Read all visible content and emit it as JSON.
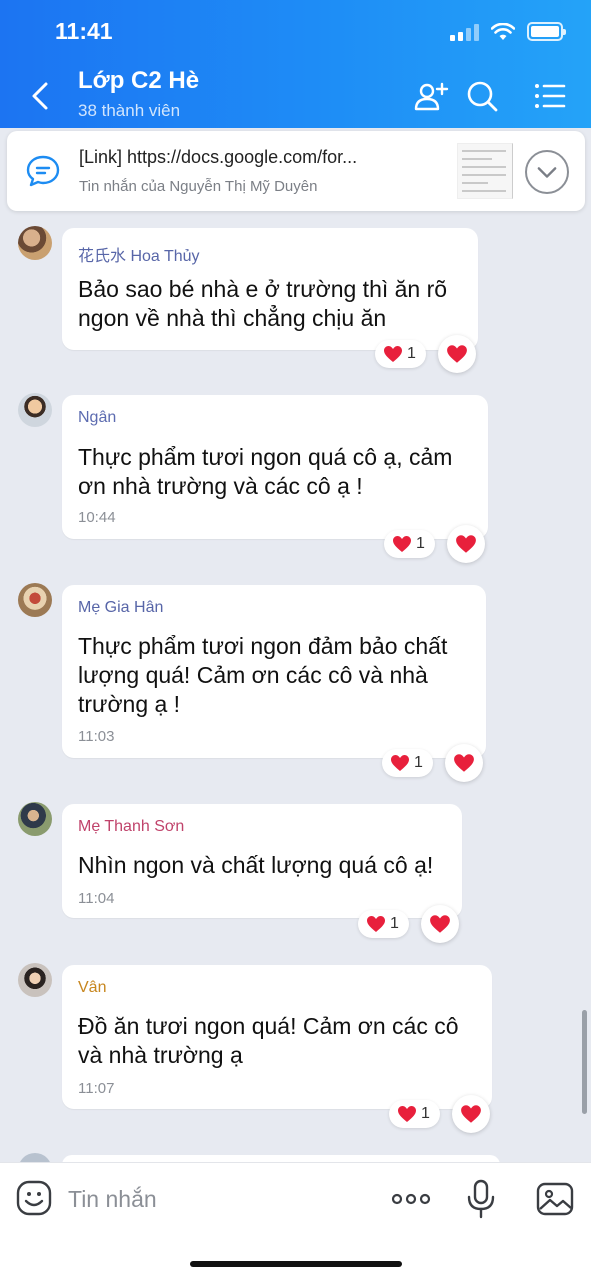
{
  "status_bar": {
    "time": "11:41"
  },
  "header": {
    "title": "Lớp C2 Hè",
    "subtitle": "38 thành viên",
    "icons": [
      "back-chevron-icon",
      "add-member-icon",
      "search-icon",
      "menu-list-icon"
    ]
  },
  "pinned": {
    "title": "[Link] https://docs.google.com/for...",
    "subtitle": "Tin nhắn của Nguyễn Thị Mỹ Duyên"
  },
  "messages": [
    {
      "sender": "花氏水 Hoa Thủy",
      "sender_color": "#5866a8",
      "text_lines": [
        "Bảo sao bé nhà e ở trường thì ăn rõ",
        "ngon về nhà thì chẳng chịu ăn"
      ],
      "time": "",
      "reaction_count": "1",
      "reaction": "heart"
    },
    {
      "sender": "Ngân",
      "sender_color": "#5c6bb0",
      "text_lines": [
        "Thực phẩm tươi ngon quá cô ạ, cảm",
        "ơn nhà trường và các cô ạ !"
      ],
      "time": "10:44",
      "reaction_count": "1",
      "reaction": "heart"
    },
    {
      "sender": "Mẹ Gia Hân",
      "sender_color": "#5866a8",
      "text_lines": [
        "Thực phẩm tươi ngon đảm bảo chất",
        "lượng quá! Cảm ơn các cô và nhà",
        "trường ạ !"
      ],
      "time": "11:03",
      "reaction_count": "1",
      "reaction": "heart"
    },
    {
      "sender": "Mẹ Thanh Sơn",
      "sender_color": "#c0436b",
      "text_lines": [
        "Nhìn ngon và chất lượng quá cô ạ!"
      ],
      "time": "11:04",
      "reaction_count": "1",
      "reaction": "heart"
    },
    {
      "sender": "Vân",
      "sender_color": "#c7861e",
      "text_lines": [
        "Đồ ăn tươi ngon quá! Cảm ơn các cô",
        "và nhà trường ạ"
      ],
      "time": "11:07",
      "reaction_count": "1",
      "reaction": "heart"
    }
  ],
  "input_bar": {
    "placeholder": "Tin nhắn",
    "icons": [
      "emoji-icon",
      "more-dots-icon",
      "microphone-icon",
      "image-icon"
    ]
  },
  "colors": {
    "header_start": "#1c74f2",
    "header_end": "#24a3f8",
    "heart": "#e8203c",
    "chat_bg": "#e7eaf1"
  }
}
